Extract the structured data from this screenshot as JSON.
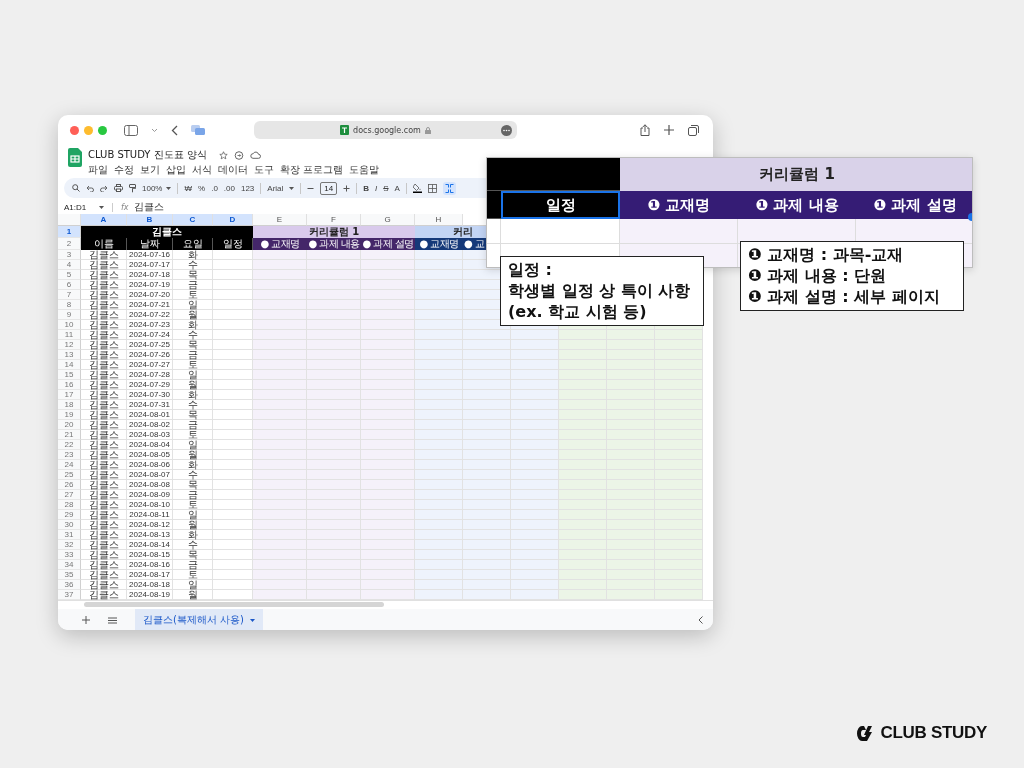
{
  "browser": {
    "url": "docs.google.com"
  },
  "doc": {
    "title": "CLUB STUDY 진도표 양식",
    "menus": [
      "파일",
      "수정",
      "보기",
      "삽입",
      "서식",
      "데이터",
      "도구",
      "확장 프로그램",
      "도움말"
    ]
  },
  "toolbar": {
    "zoom": "100%",
    "formats": [
      "₩",
      "%",
      ".0",
      ".00",
      "123"
    ],
    "font": "Arial",
    "font_size": "14",
    "styles": [
      {
        "label": "B",
        "kind": "bold"
      },
      {
        "label": "I",
        "kind": "italic"
      },
      {
        "label": "S",
        "kind": "strike"
      },
      {
        "label": "A",
        "kind": "color"
      }
    ]
  },
  "formula_bar": {
    "cell_ref": "A1:D1",
    "fx": "fx",
    "value": "김클스"
  },
  "sheet": {
    "columns": [
      {
        "letter": "A",
        "selected": true
      },
      {
        "letter": "B",
        "selected": true
      },
      {
        "letter": "C",
        "selected": true
      },
      {
        "letter": "D",
        "selected": true
      },
      {
        "letter": "E",
        "selected": false
      },
      {
        "letter": "F",
        "selected": false
      },
      {
        "letter": "G",
        "selected": false
      },
      {
        "letter": "H",
        "selected": false
      }
    ],
    "header_rows": [
      {
        "num": "1",
        "selected": true
      },
      {
        "num": "2",
        "selected": false
      }
    ],
    "title_cell": "김클스",
    "field_headers": [
      "이름",
      "날짜",
      "요일",
      "일정"
    ],
    "curricula": [
      {
        "title": "커리큘럼 1",
        "color": "#f5f1fa",
        "subheaders": [
          "● 교재명",
          "● 과제 내용",
          "● 과제 설명"
        ]
      },
      {
        "title": "커리",
        "color": "#eef3fc",
        "subheaders": [
          "● 교재명",
          "● 교"
        ]
      },
      {
        "color": "#ecf5e7"
      }
    ],
    "rows": [
      {
        "num": "3",
        "name": "김클스",
        "date": "2024-07-16",
        "day": "화"
      },
      {
        "num": "4",
        "name": "김클스",
        "date": "2024-07-17",
        "day": "수"
      },
      {
        "num": "5",
        "name": "김클스",
        "date": "2024-07-18",
        "day": "목"
      },
      {
        "num": "6",
        "name": "김클스",
        "date": "2024-07-19",
        "day": "금"
      },
      {
        "num": "7",
        "name": "김클스",
        "date": "2024-07-20",
        "day": "토"
      },
      {
        "num": "8",
        "name": "김클스",
        "date": "2024-07-21",
        "day": "일"
      },
      {
        "num": "9",
        "name": "김클스",
        "date": "2024-07-22",
        "day": "월"
      },
      {
        "num": "10",
        "name": "김클스",
        "date": "2024-07-23",
        "day": "화"
      },
      {
        "num": "11",
        "name": "김클스",
        "date": "2024-07-24",
        "day": "수"
      },
      {
        "num": "12",
        "name": "김클스",
        "date": "2024-07-25",
        "day": "목"
      },
      {
        "num": "13",
        "name": "김클스",
        "date": "2024-07-26",
        "day": "금"
      },
      {
        "num": "14",
        "name": "김클스",
        "date": "2024-07-27",
        "day": "토"
      },
      {
        "num": "15",
        "name": "김클스",
        "date": "2024-07-28",
        "day": "일"
      },
      {
        "num": "16",
        "name": "김클스",
        "date": "2024-07-29",
        "day": "월"
      },
      {
        "num": "17",
        "name": "김클스",
        "date": "2024-07-30",
        "day": "화"
      },
      {
        "num": "18",
        "name": "김클스",
        "date": "2024-07-31",
        "day": "수"
      },
      {
        "num": "19",
        "name": "김클스",
        "date": "2024-08-01",
        "day": "목"
      },
      {
        "num": "20",
        "name": "김클스",
        "date": "2024-08-02",
        "day": "금"
      },
      {
        "num": "21",
        "name": "김클스",
        "date": "2024-08-03",
        "day": "토"
      },
      {
        "num": "22",
        "name": "김클스",
        "date": "2024-08-04",
        "day": "일"
      },
      {
        "num": "23",
        "name": "김클스",
        "date": "2024-08-05",
        "day": "월"
      },
      {
        "num": "24",
        "name": "김클스",
        "date": "2024-08-06",
        "day": "화"
      },
      {
        "num": "25",
        "name": "김클스",
        "date": "2024-08-07",
        "day": "수"
      },
      {
        "num": "26",
        "name": "김클스",
        "date": "2024-08-08",
        "day": "목"
      },
      {
        "num": "27",
        "name": "김클스",
        "date": "2024-08-09",
        "day": "금"
      },
      {
        "num": "28",
        "name": "김클스",
        "date": "2024-08-10",
        "day": "토"
      },
      {
        "num": "29",
        "name": "김클스",
        "date": "2024-08-11",
        "day": "일"
      },
      {
        "num": "30",
        "name": "김클스",
        "date": "2024-08-12",
        "day": "월"
      },
      {
        "num": "31",
        "name": "김클스",
        "date": "2024-08-13",
        "day": "화"
      },
      {
        "num": "32",
        "name": "김클스",
        "date": "2024-08-14",
        "day": "수"
      },
      {
        "num": "33",
        "name": "김클스",
        "date": "2024-08-15",
        "day": "목"
      },
      {
        "num": "34",
        "name": "김클스",
        "date": "2024-08-16",
        "day": "금"
      },
      {
        "num": "35",
        "name": "김클스",
        "date": "2024-08-17",
        "day": "토"
      },
      {
        "num": "36",
        "name": "김클스",
        "date": "2024-08-18",
        "day": "일"
      },
      {
        "num": "37",
        "name": "김클스",
        "date": "2024-08-19",
        "day": "월"
      }
    ],
    "sheet_tabs": [
      {
        "label": "김클스(복제해서 사용)",
        "selected": true
      }
    ]
  },
  "magnified": {
    "title": "커리큘럼 1",
    "headers": [
      "일정",
      "❶ 교재명",
      "❶ 과제 내용",
      "❶ 과제 설명"
    ]
  },
  "notes": [
    {
      "lines": [
        "일정 :",
        "학생별 일정 상 특이 사항",
        "(ex. 학교 시험 등)"
      ]
    },
    {
      "lines": [
        "❶ 교재명 : 과목-교재",
        "❶ 과제 내용 : 단원",
        "❶ 과제 설명 : 세부 페이지"
      ]
    }
  ],
  "brand": "CLUB STUDY"
}
